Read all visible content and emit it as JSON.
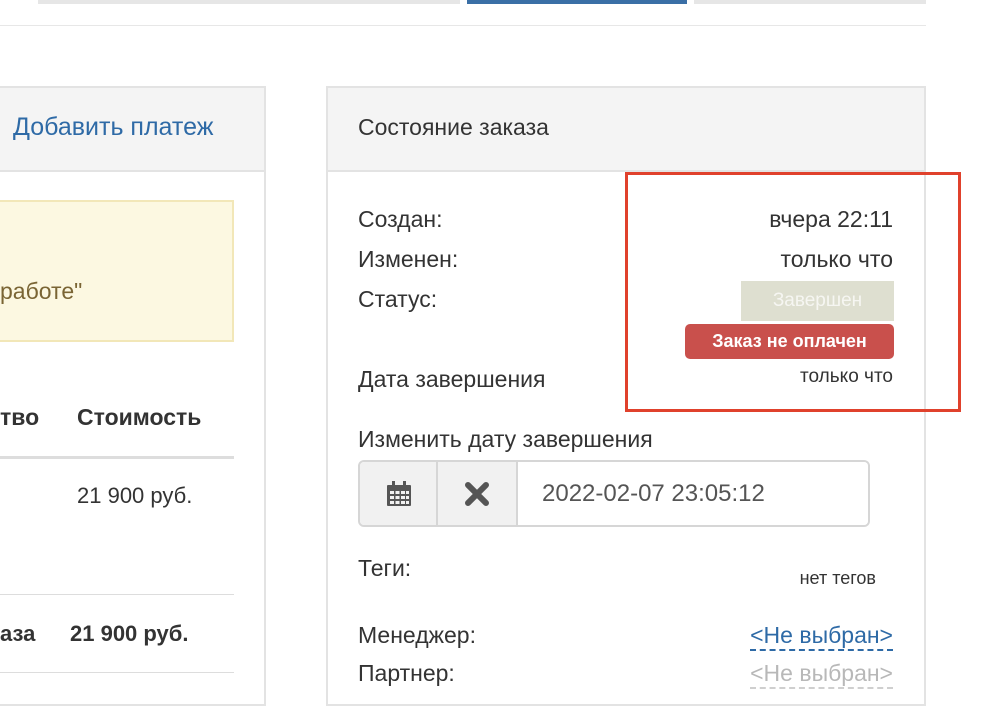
{
  "left_panel": {
    "add_payment_link": "Добавить платеж",
    "notice_text_fragment": "работе\"",
    "table": {
      "headers": [
        "тво",
        "Стоимость"
      ],
      "rows": [
        {
          "qty": "",
          "cost": "21 900 руб."
        }
      ],
      "total": {
        "label": "аза",
        "value": "21 900 руб."
      }
    }
  },
  "order_state": {
    "title": "Состояние заказа",
    "created": {
      "label": "Создан:",
      "value": "вчера 22:11"
    },
    "modified": {
      "label": "Изменен:",
      "value": "только что"
    },
    "status": {
      "label": "Статус:",
      "value": "Завершен",
      "badge": "Заказ не оплачен"
    },
    "completion_date": {
      "label": "Дата завершения",
      "value": "только что"
    },
    "change_completion": {
      "label": "Изменить дату завершения",
      "input_value": "2022-02-07 23:05:12",
      "calendar_icon": "calendar-icon",
      "clear_icon": "clear-icon"
    },
    "tags": {
      "label": "Теги:",
      "value": "нет тегов"
    },
    "manager": {
      "label": "Менеджер:",
      "value": "<Не выбран>"
    },
    "partner": {
      "label": "Партнер:",
      "value": "<Не выбран>"
    }
  },
  "colors": {
    "link": "#2e6aa6",
    "status_done_bg": "#dedfd0",
    "unpaid_badge_bg": "#c9504c",
    "highlight_border": "#e0412c",
    "notice_bg": "#fcf8e1"
  }
}
